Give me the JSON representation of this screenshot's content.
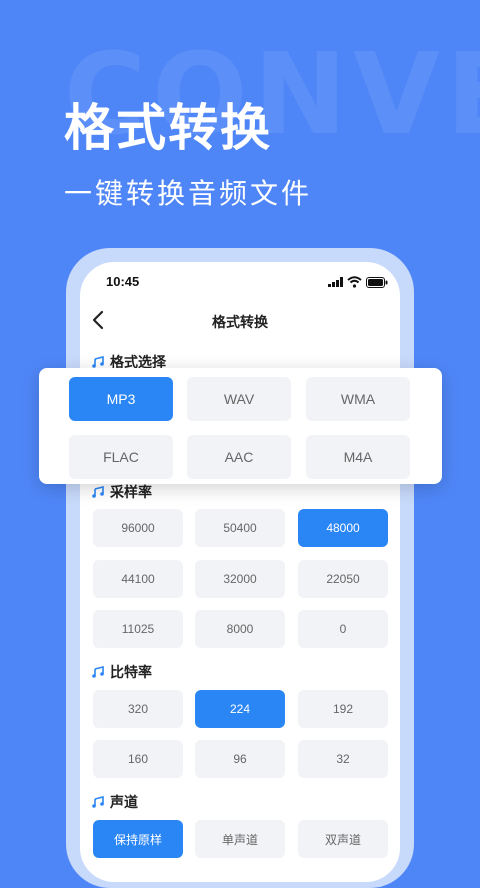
{
  "background": {
    "watermark": "CONVE",
    "headline": "格式转换",
    "subhead": "一键转换音频文件"
  },
  "phone": {
    "status": {
      "time": "10:45"
    },
    "nav": {
      "title": "格式转换"
    },
    "format_section": {
      "title": "格式选择",
      "options": [
        "MP3",
        "WAV",
        "WMA",
        "FLAC",
        "AAC",
        "M4A"
      ],
      "selected": "MP3"
    },
    "sample_rate_section": {
      "title": "采样率",
      "options": [
        "96000",
        "50400",
        "48000",
        "44100",
        "32000",
        "22050",
        "11025",
        "8000",
        "0"
      ],
      "selected": "48000"
    },
    "bitrate_section": {
      "title": "比特率",
      "options": [
        "320",
        "224",
        "192",
        "160",
        "96",
        "32"
      ],
      "selected": "224"
    },
    "channel_section": {
      "title": "声道",
      "options": [
        "保持原样",
        "单声道",
        "双声道"
      ],
      "selected": "保持原样"
    }
  },
  "colors": {
    "background": "#4f86f7",
    "accent": "#2b86f5",
    "option_bg": "#f1f3f6"
  }
}
